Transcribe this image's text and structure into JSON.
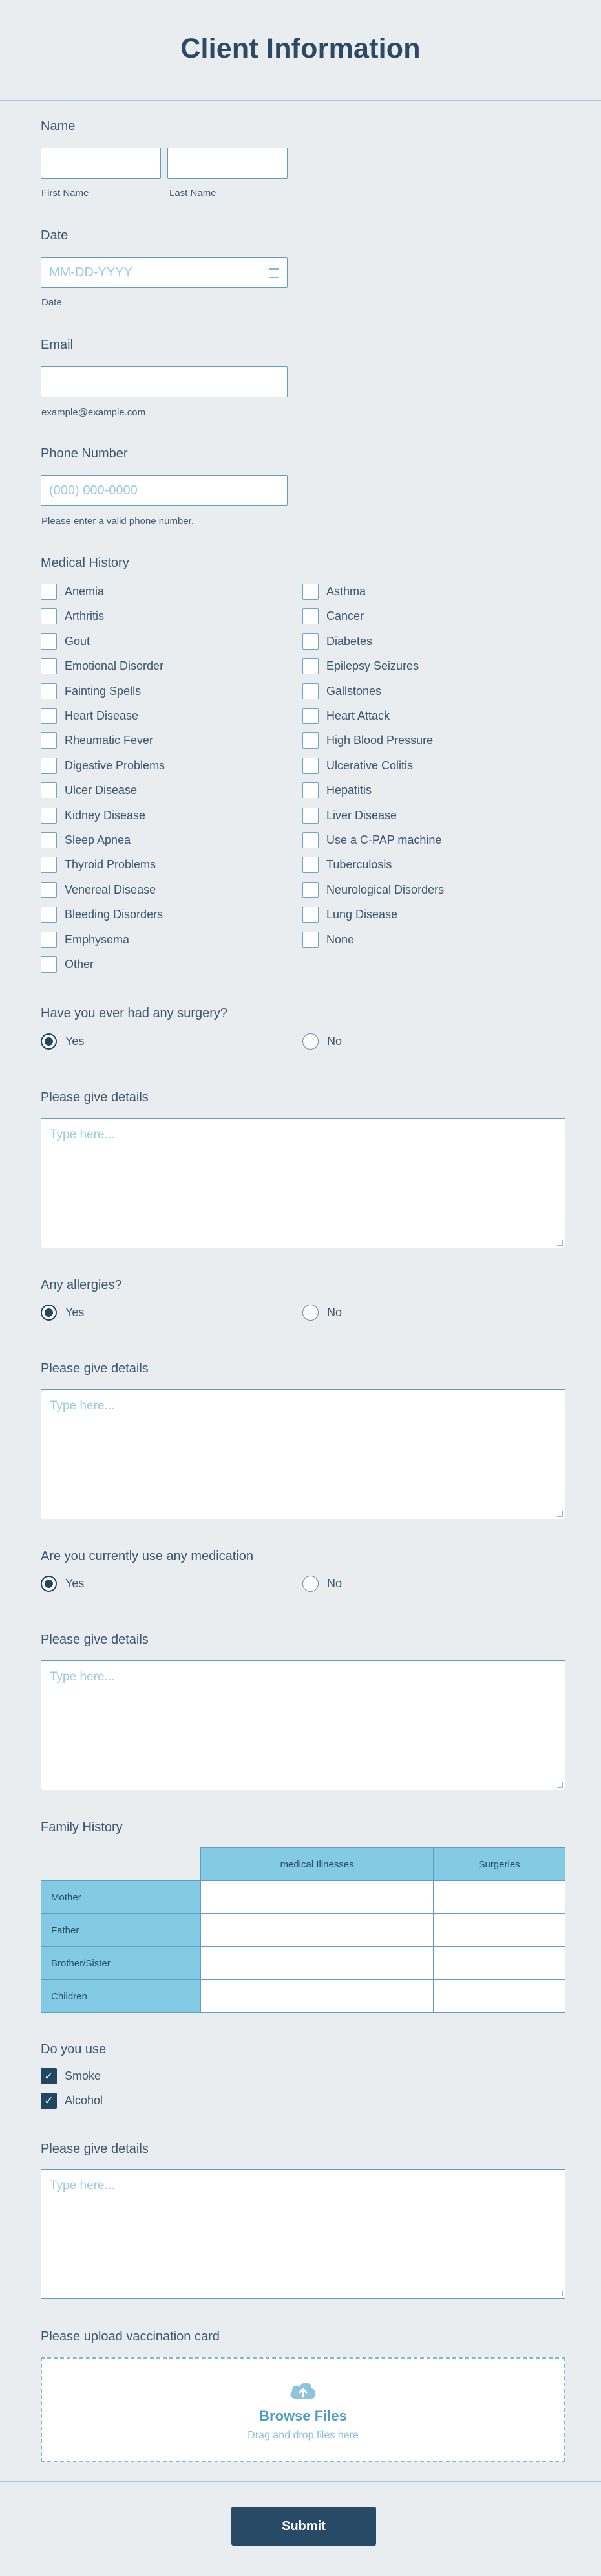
{
  "title": "Client Information",
  "name": {
    "label": "Name",
    "first_sub": "First Name",
    "last_sub": "Last Name"
  },
  "date": {
    "label": "Date",
    "placeholder": "MM-DD-YYYY",
    "sub": "Date"
  },
  "email": {
    "label": "Email",
    "sub": "example@example.com"
  },
  "phone": {
    "label": "Phone Number",
    "placeholder": "(000) 000-0000",
    "sub": "Please enter a valid phone number."
  },
  "medical_history": {
    "label": "Medical History",
    "left": [
      "Anemia",
      "Arthritis",
      "Gout",
      "Emotional Disorder",
      "Fainting Spells",
      "Heart Disease",
      "Rheumatic Fever",
      "Digestive Problems",
      "Ulcer Disease",
      "Kidney Disease",
      "Sleep Apnea",
      "Thyroid Problems",
      "Venereal Disease",
      "Bleeding Disorders",
      "Emphysema",
      "Other"
    ],
    "right": [
      "Asthma",
      "Cancer",
      "Diabetes",
      "Epilepsy Seizures",
      "Gallstones",
      "Heart Attack",
      "High Blood Pressure",
      "Ulcerative Colitis",
      "Hepatitis",
      "Liver Disease",
      "Use a C-PAP machine",
      "Tuberculosis",
      "Neurological Disorders",
      "Lung Disease",
      "None"
    ]
  },
  "surgery": {
    "label": "Have you ever had any surgery?",
    "yes": "Yes",
    "no": "No",
    "selected": "Yes"
  },
  "details1": {
    "label": "Please give details",
    "placeholder": "Type here..."
  },
  "allergies": {
    "label": "Any allergies?",
    "yes": "Yes",
    "no": "No",
    "selected": "Yes"
  },
  "details2": {
    "label": "Please give details",
    "placeholder": "Type here..."
  },
  "medication": {
    "label": "Are you currently use any medication",
    "yes": "Yes",
    "no": "No",
    "selected": "Yes"
  },
  "details3": {
    "label": "Please give details",
    "placeholder": "Type here..."
  },
  "family_history": {
    "label": "Family History",
    "columns": [
      "medical Illnesses",
      "Surgeries"
    ],
    "rows": [
      "Mother",
      "Father",
      "Brother/Sister",
      "Children"
    ]
  },
  "do_you_use": {
    "label": "Do you use",
    "options": [
      "Smoke",
      "Alcohol"
    ],
    "checked": [
      "Smoke",
      "Alcohol"
    ]
  },
  "details4": {
    "label": "Please give details",
    "placeholder": "Type here..."
  },
  "upload": {
    "label": "Please upload vaccination card",
    "browse": "Browse Files",
    "drag": "Drag and drop files here"
  },
  "submit": "Submit",
  "colors": {
    "accent": "#274a66",
    "border": "#5f9fbc",
    "table_header": "#83cbe4",
    "background": "#e9edf0"
  }
}
